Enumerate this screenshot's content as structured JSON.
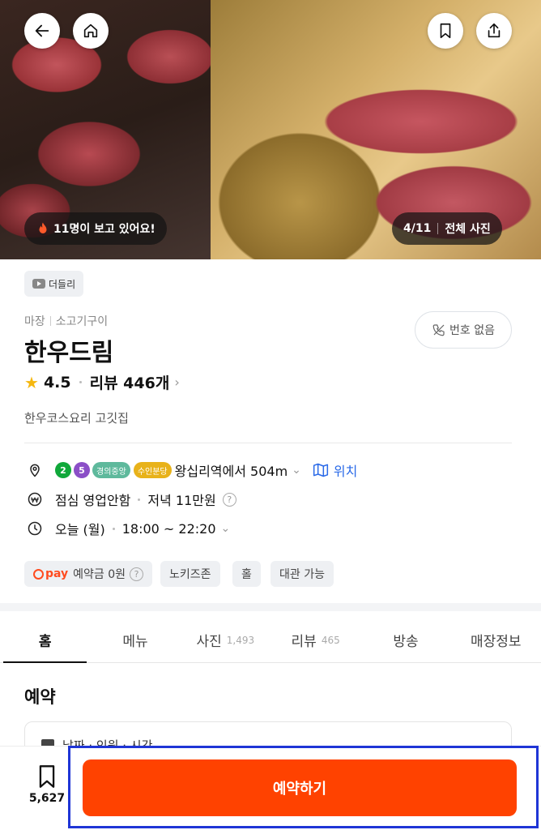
{
  "hero": {
    "viewers_text": "11명이 보고 있어요!",
    "photo_counter": "4/11",
    "all_photos": "전체 사진"
  },
  "store": {
    "source_tag": "더들리",
    "category_primary": "마장",
    "category_secondary": "소고기구이",
    "name": "한우드림",
    "rating": "4.5",
    "review_label": "리뷰 446개",
    "description": "한우코스요리 고깃집",
    "no_phone_label": "번호 없음"
  },
  "info": {
    "line_badges": [
      {
        "label": "2",
        "color": "#10a83a"
      },
      {
        "label": "5",
        "color": "#8b4fc7"
      }
    ],
    "line_tags": [
      {
        "label": "경의중앙",
        "color": "#5eb99c"
      },
      {
        "label": "수인분당",
        "color": "#e8b21a"
      }
    ],
    "distance_text": "왕십리역에서 504m",
    "location_link": "위치",
    "lunch_text": "점심 영업안함",
    "dinner_price": "저녁 11만원",
    "hours_day": "오늘 (월)",
    "hours_range": "18:00 ~ 22:20"
  },
  "chips": {
    "pay_brand": "pay",
    "deposit": "예약금 0원",
    "items": [
      "노키즈존",
      "홀",
      "대관 가능"
    ]
  },
  "tabs": [
    {
      "label": "홈",
      "count": "",
      "active": true
    },
    {
      "label": "메뉴",
      "count": "",
      "active": false
    },
    {
      "label": "사진",
      "count": "1,493",
      "active": false
    },
    {
      "label": "리뷰",
      "count": "465",
      "active": false
    },
    {
      "label": "방송",
      "count": "",
      "active": false
    },
    {
      "label": "매장정보",
      "count": "",
      "active": false
    }
  ],
  "reservation": {
    "section_title": "예약",
    "picker_text": "날짜 · 인원 · 시간"
  },
  "bottom": {
    "save_count": "5,627",
    "reserve_button": "예약하기"
  },
  "colors": {
    "accent": "#ff4200",
    "link": "#2a6ae8",
    "star": "#f5b70f",
    "highlight_box": "#1f35d6"
  }
}
